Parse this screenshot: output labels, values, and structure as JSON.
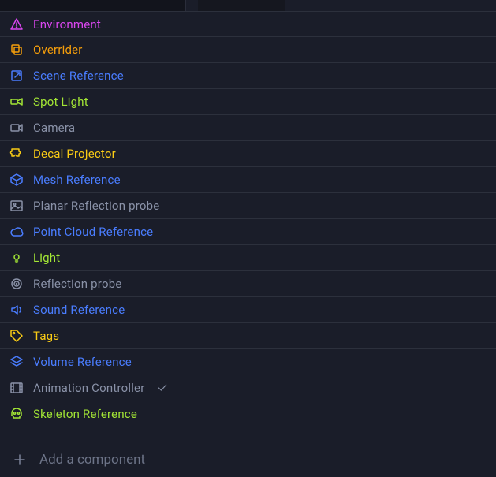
{
  "components": [
    {
      "id": "environment",
      "label": "Environment",
      "icon": "warning-icon",
      "color": "magenta",
      "check": false
    },
    {
      "id": "overrider",
      "label": "Overrider",
      "icon": "copy-icon",
      "color": "orange",
      "check": false
    },
    {
      "id": "scene-reference",
      "label": "Scene Reference",
      "icon": "popout-icon",
      "color": "blue",
      "check": false
    },
    {
      "id": "spot-light",
      "label": "Spot Light",
      "icon": "spotlight-icon",
      "color": "lime",
      "check": false
    },
    {
      "id": "camera",
      "label": "Camera",
      "icon": "camera-icon",
      "color": "gray",
      "check": false
    },
    {
      "id": "decal-projector",
      "label": "Decal Projector",
      "icon": "puzzle-icon",
      "color": "yellow",
      "check": false
    },
    {
      "id": "mesh-reference",
      "label": "Mesh Reference",
      "icon": "cube-icon",
      "color": "blue",
      "check": false
    },
    {
      "id": "planar-reflection",
      "label": "Planar Reflection probe",
      "icon": "image-icon",
      "color": "gray",
      "check": false
    },
    {
      "id": "point-cloud-reference",
      "label": "Point Cloud Reference",
      "icon": "cloud-icon",
      "color": "blue",
      "check": false
    },
    {
      "id": "light",
      "label": "Light",
      "icon": "bulb-icon",
      "color": "lime",
      "check": false
    },
    {
      "id": "reflection-probe",
      "label": "Reflection probe",
      "icon": "target-icon",
      "color": "gray",
      "check": false
    },
    {
      "id": "sound-reference",
      "label": "Sound Reference",
      "icon": "speaker-icon",
      "color": "blue",
      "check": false
    },
    {
      "id": "tags",
      "label": "Tags",
      "icon": "tag-icon",
      "color": "yellow",
      "check": false
    },
    {
      "id": "volume-reference",
      "label": "Volume Reference",
      "icon": "layers-icon",
      "color": "blue",
      "check": false
    },
    {
      "id": "animation-controller",
      "label": "Animation Controller",
      "icon": "film-icon",
      "color": "gray",
      "check": true
    },
    {
      "id": "skeleton-reference",
      "label": "Skeleton Reference",
      "icon": "skull-icon",
      "color": "lime",
      "check": false
    }
  ],
  "footer": {
    "placeholder": "Add a component"
  }
}
